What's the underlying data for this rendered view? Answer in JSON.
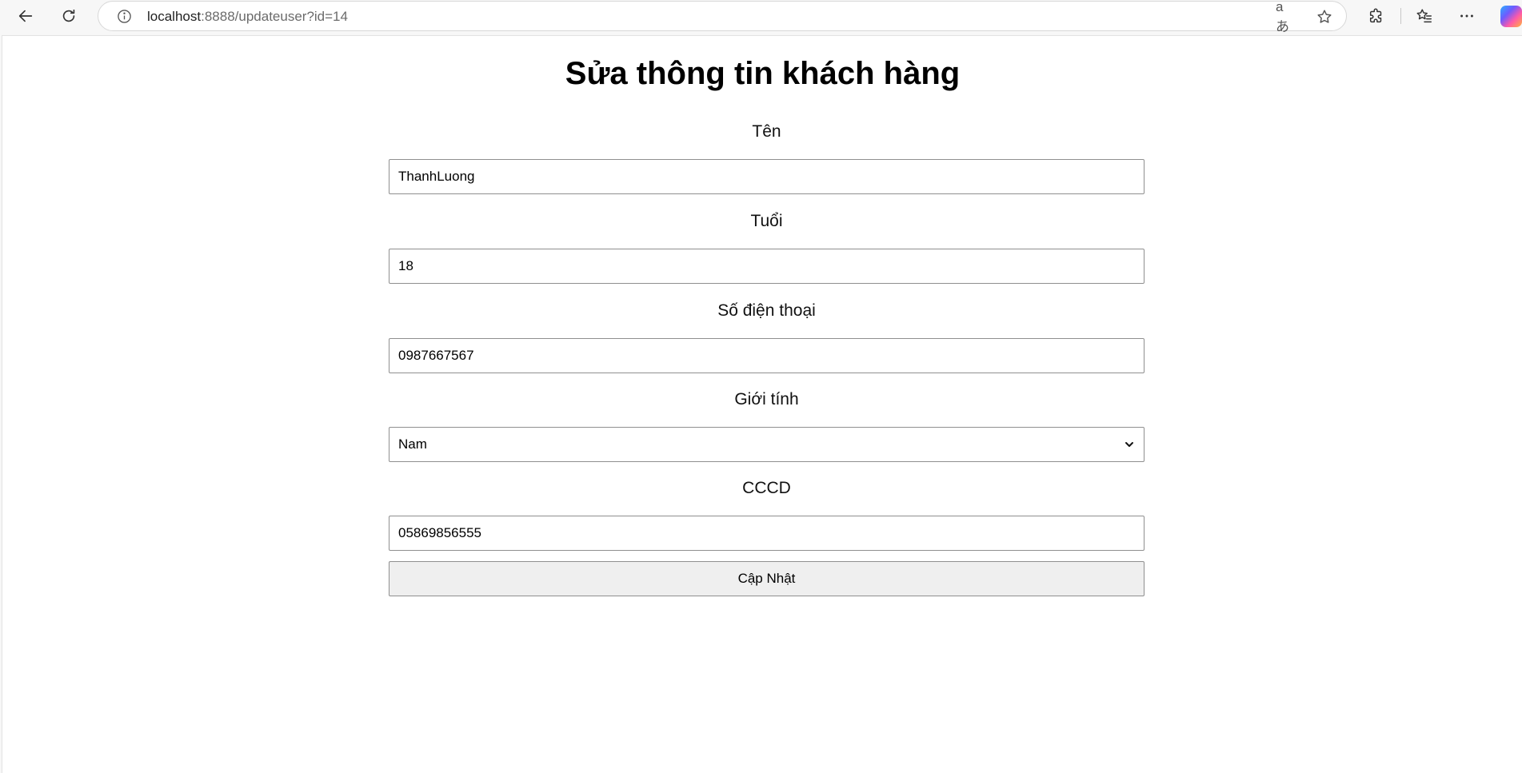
{
  "browser": {
    "url_host": "localhost",
    "url_rest": ":8888/updateuser?id=14",
    "icons": [
      "back-arrow-icon",
      "refresh-icon",
      "info-icon",
      "translate-icon",
      "star-icon",
      "extensions-icon",
      "favorites-icon",
      "more-icon",
      "copilot-icon"
    ],
    "translate_glyph": "aあ"
  },
  "page": {
    "title": "Sửa thông tin khách hàng"
  },
  "form": {
    "name": {
      "label": "Tên",
      "value": "ThanhLuong"
    },
    "age": {
      "label": "Tuổi",
      "value": "18"
    },
    "phone": {
      "label": "Số điện thoại",
      "value": "0987667567"
    },
    "gender": {
      "label": "Giới tính",
      "selected": "Nam"
    },
    "id_card": {
      "label": "CCCD",
      "value": "05869856555"
    },
    "submit_label": "Cập Nhật"
  }
}
